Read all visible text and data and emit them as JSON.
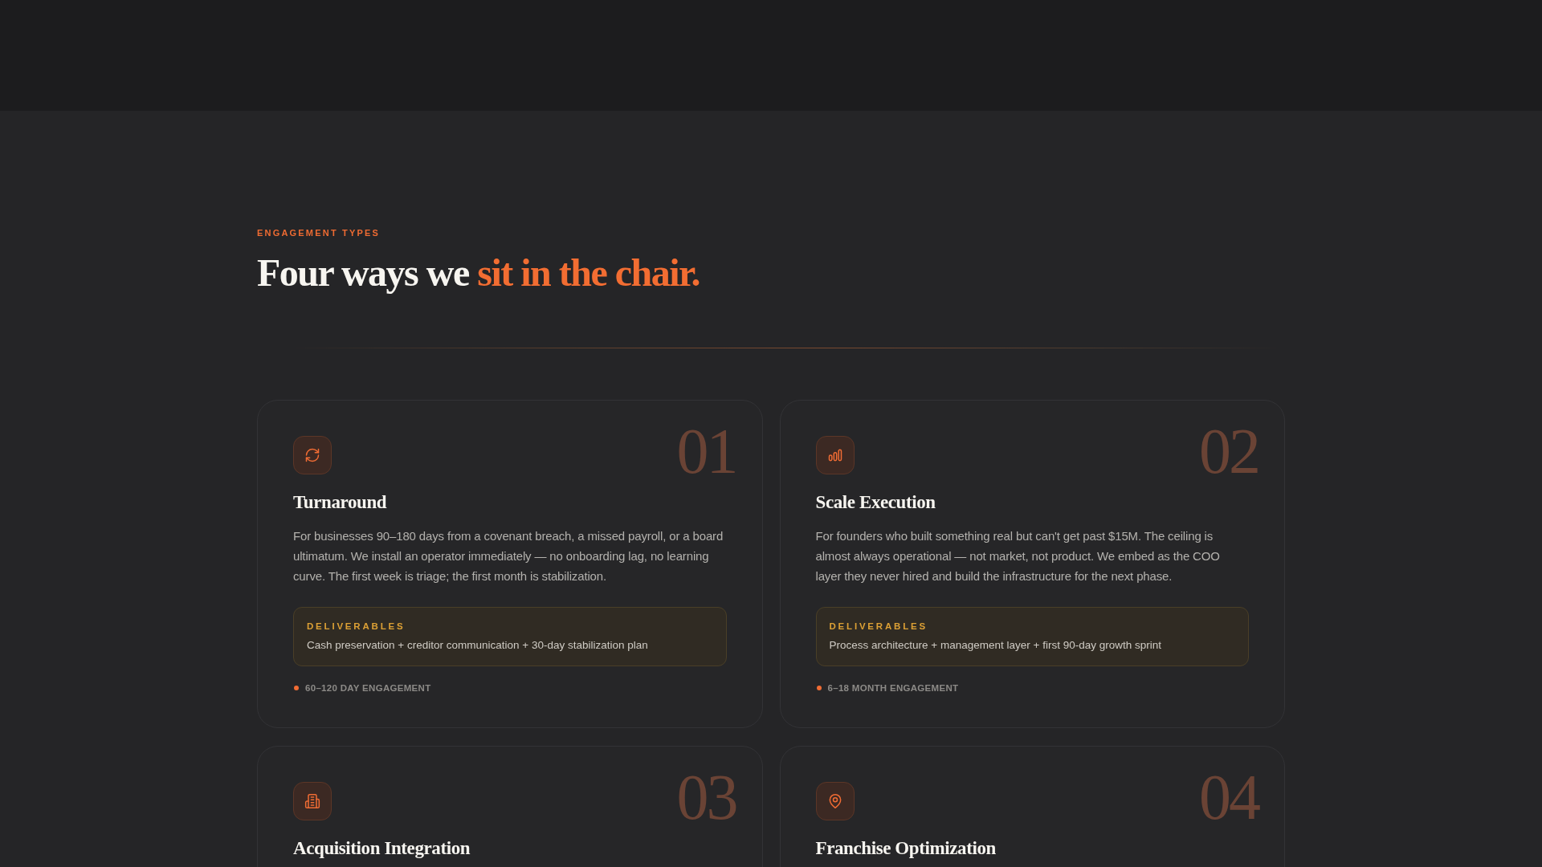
{
  "section": {
    "eyebrow": "ENGAGEMENT TYPES",
    "heading": {
      "text": "Four ways we",
      "highlight": "sit in the chair."
    }
  },
  "cards": [
    {
      "number": "01",
      "title": "Turnaround",
      "description": "For businesses 90–180 days from a covenant breach, a missed payroll, or a board ultimatum. We install an operator immediately — no onboarding lag, no learning curve. The first week is triage; the first month is stabilization.",
      "deliverables": {
        "label": "DELIVERABLES",
        "text": "Cash preservation + creditor communication + 30-day stabilization plan"
      },
      "duration": "60–120 DAY ENGAGEMENT"
    },
    {
      "number": "02",
      "title": "Scale Execution",
      "description": "For founders who built something real but can't get past $15M. The ceiling is almost always operational — not market, not product. We embed as the COO layer they never hired and build the infrastructure for the next phase.",
      "deliverables": {
        "label": "DELIVERABLES",
        "text": "Process architecture + management layer + first 90-day growth sprint"
      },
      "duration": "6–18 MONTH ENGAGEMENT"
    },
    {
      "number": "03",
      "title": "Acquisition Integration"
    },
    {
      "number": "04",
      "title": "Franchise Optimization"
    }
  ]
}
